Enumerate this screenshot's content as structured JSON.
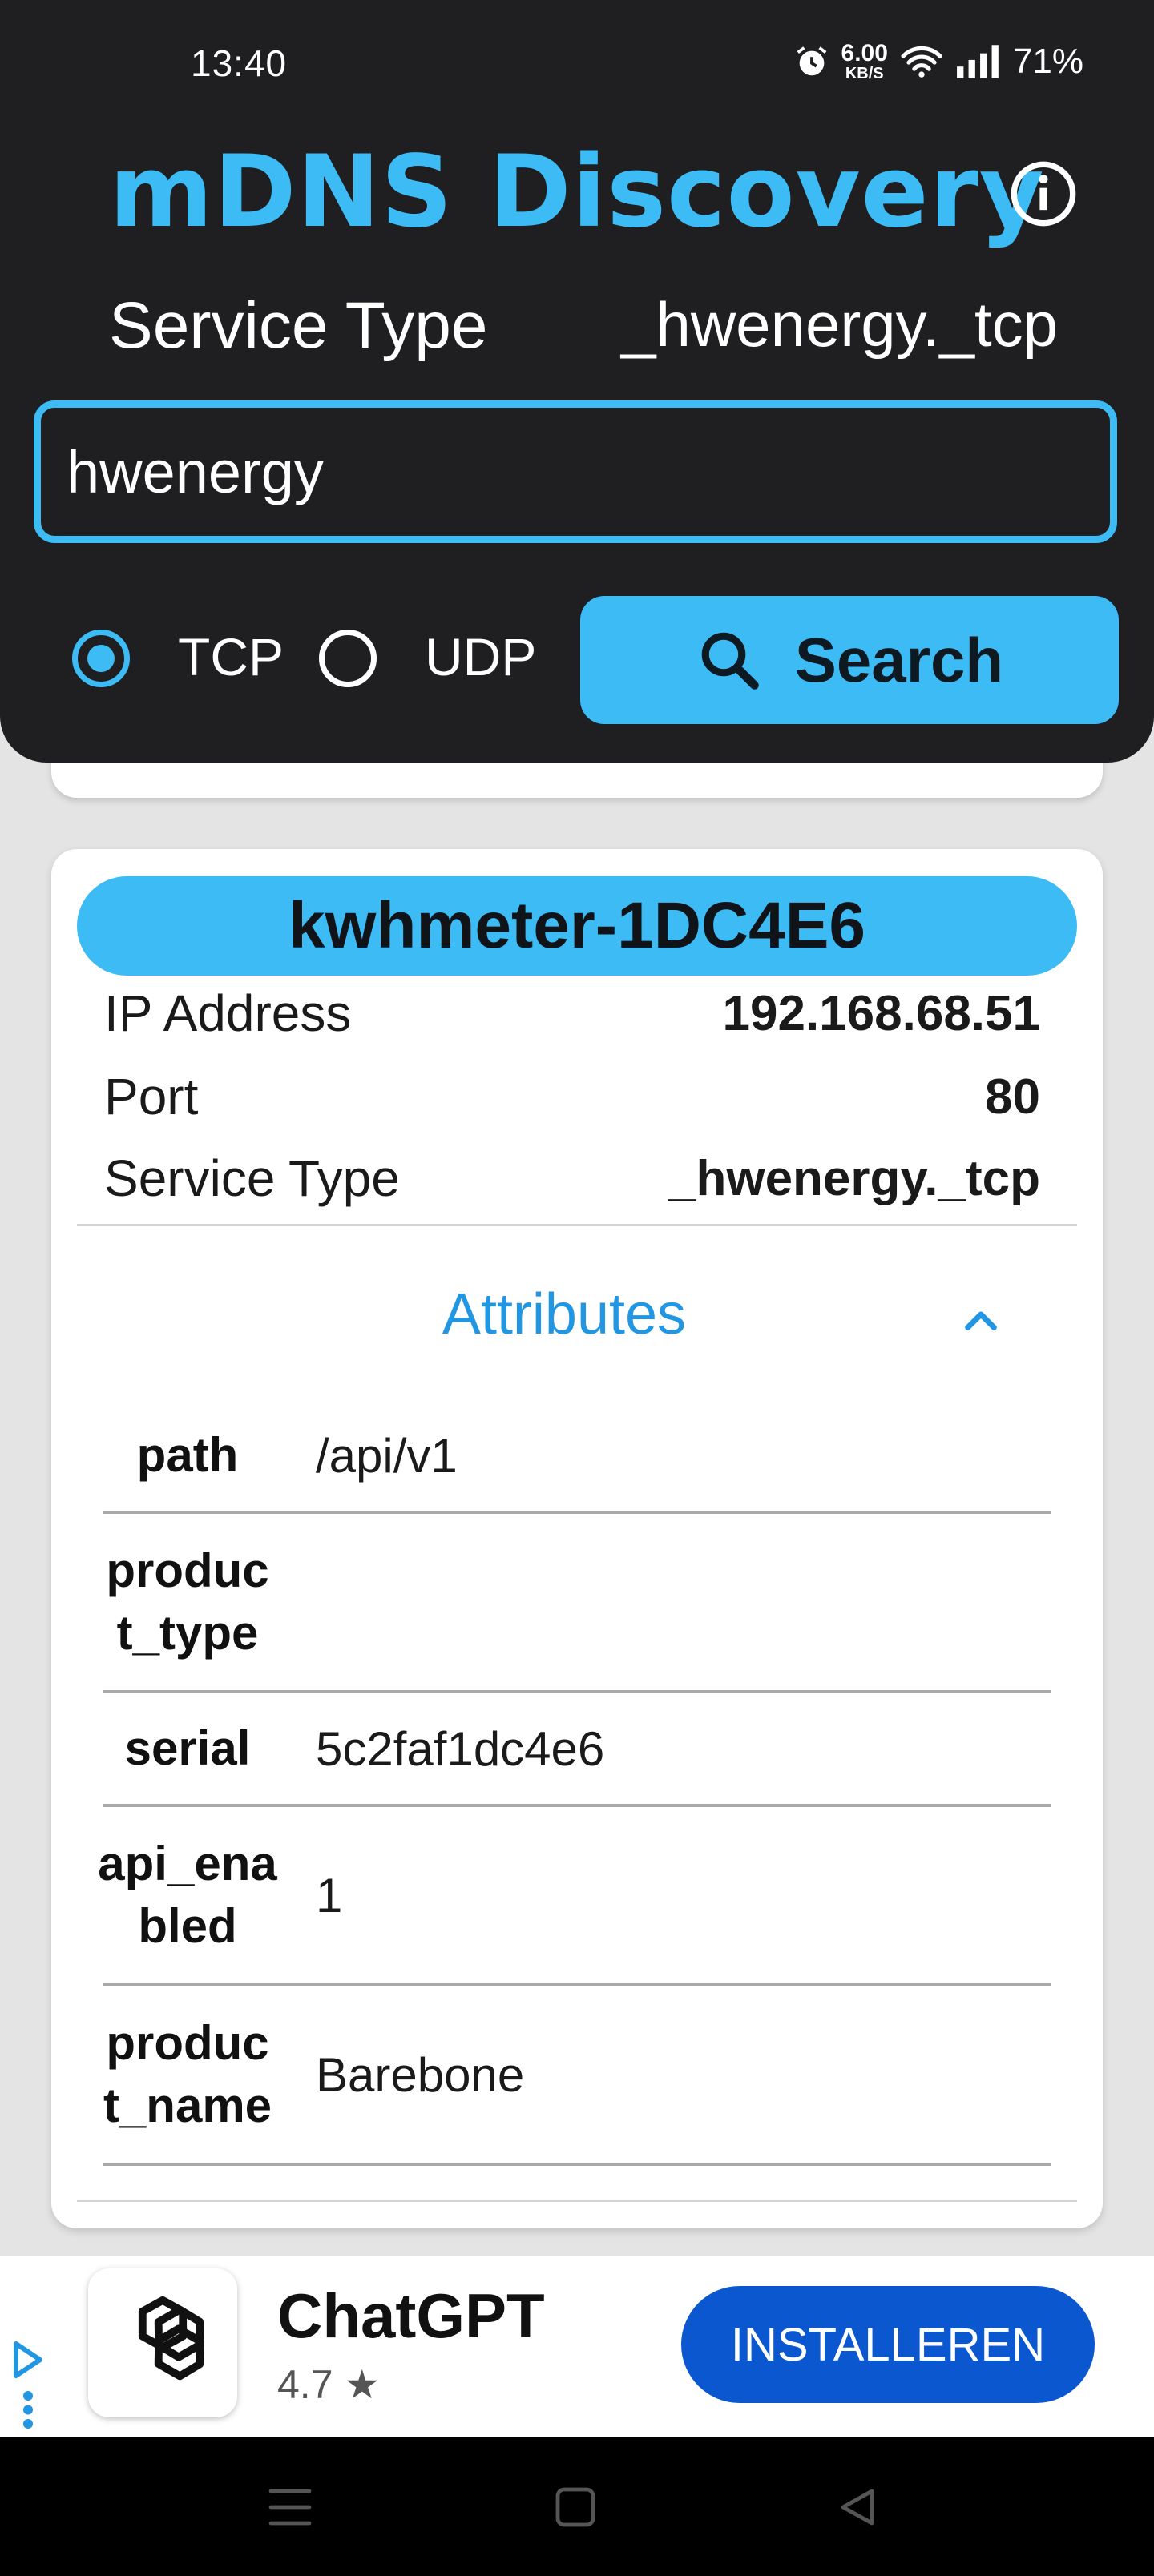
{
  "status_bar": {
    "time": "13:40",
    "net_speed": "6.00",
    "net_speed_unit": "KB/S",
    "battery": "71%",
    "icons": [
      "alarm-icon",
      "wifi-icon",
      "signal-icon"
    ]
  },
  "header": {
    "title": "mDNS Discovery",
    "info_icon": "info-icon",
    "service_type_label": "Service Type",
    "service_type_value": "_hwenergy._tcp",
    "search_value": "hwenergy",
    "protocols": [
      {
        "label": "TCP",
        "selected": true
      },
      {
        "label": "UDP",
        "selected": false
      }
    ],
    "search_button_label": "Search",
    "accent_color": "#3dbbf5"
  },
  "result": {
    "device_name": "kwhmeter-1DC4E6",
    "fields": [
      {
        "label": "IP Address",
        "value": "192.168.68.51"
      },
      {
        "label": "Port",
        "value": "80"
      },
      {
        "label": "Service Type",
        "value": "_hwenergy._tcp"
      }
    ],
    "attributes_title": "Attributes",
    "attributes": [
      {
        "key": "path",
        "value": "/api/v1"
      },
      {
        "key": "produc\nt_type",
        "value": ""
      },
      {
        "key": "serial",
        "value": "5c2faf1dc4e6"
      },
      {
        "key": "api_ena\nbled",
        "value": "1"
      },
      {
        "key": "produc\nt_name",
        "value": "Barebone"
      }
    ]
  },
  "ad": {
    "app_name": "ChatGPT",
    "rating": "4.7 ★",
    "install_label": "INSTALLEREN",
    "button_color": "#0b57d0"
  }
}
